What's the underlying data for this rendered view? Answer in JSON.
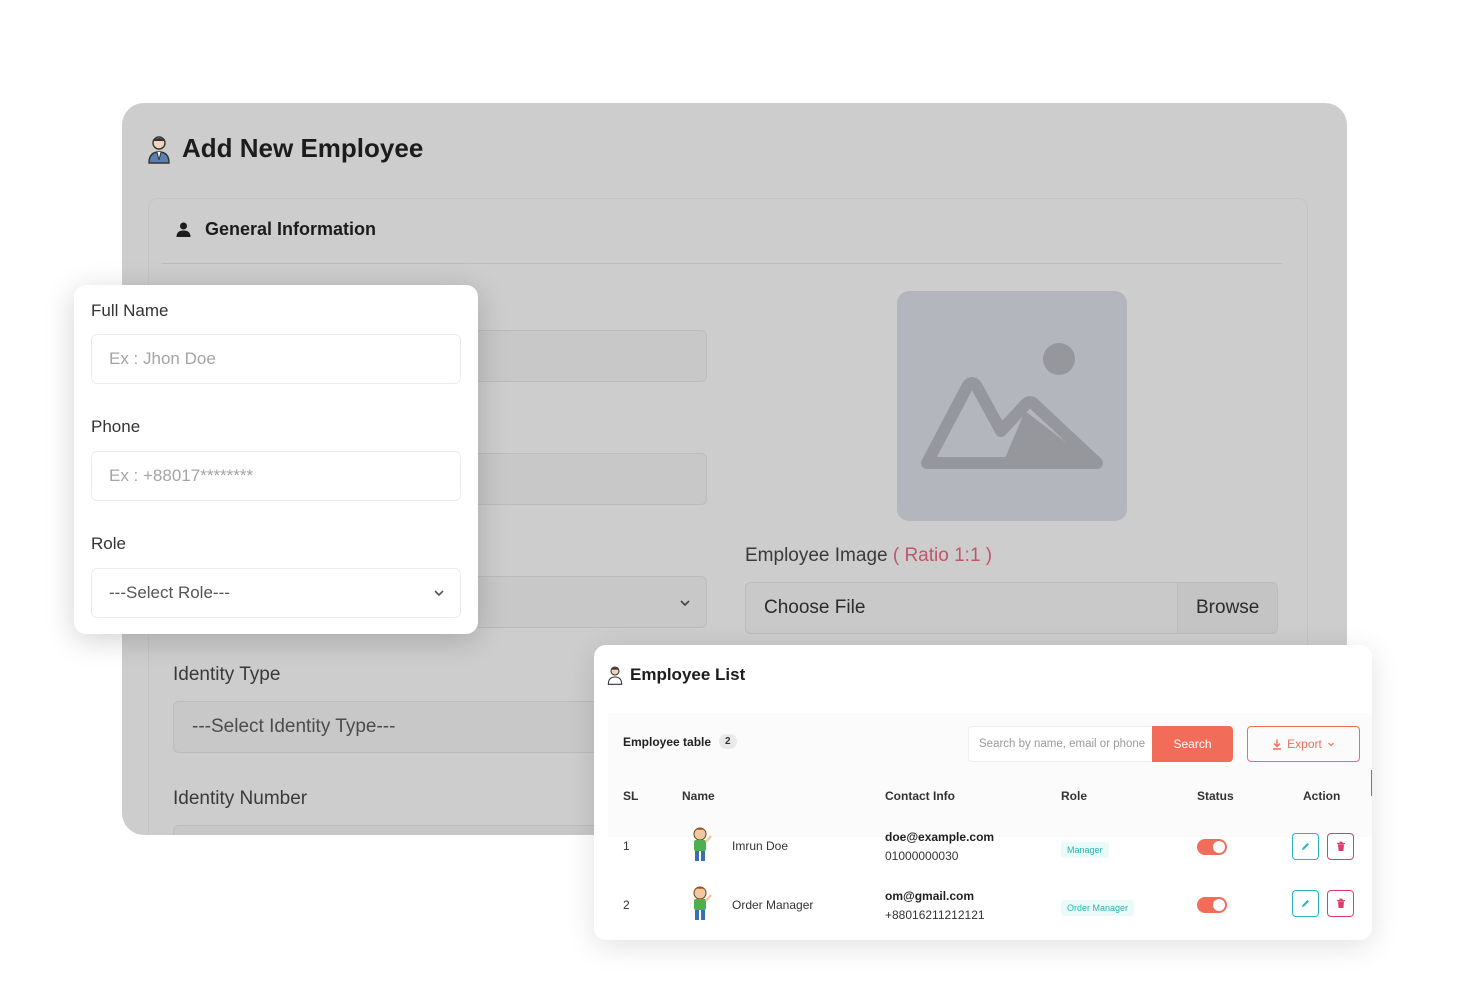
{
  "background_form": {
    "title": "Add New Employee",
    "section_title": "General Information",
    "identity_type_label": "Identity Type",
    "identity_type_placeholder": "---Select Identity Type---",
    "identity_number_label": "Identity Number",
    "employee_image_label": "Employee Image",
    "employee_image_ratio": "( Ratio 1:1 )",
    "file_input_text": "Choose File",
    "browse_label": "Browse"
  },
  "front_form": {
    "full_name_label": "Full Name",
    "full_name_placeholder": "Ex : Jhon Doe",
    "phone_label": "Phone",
    "phone_placeholder": "Ex : +88017********",
    "role_label": "Role",
    "role_selected": "---Select Role---"
  },
  "employee_list": {
    "title": "Employee List",
    "table_label": "Employee table",
    "table_count": "2",
    "search_placeholder": "Search by name, email or phone",
    "search_button": "Search",
    "export_button": "Export",
    "columns": [
      "SL",
      "Name",
      "Contact Info",
      "Role",
      "Status",
      "Action"
    ],
    "rows": [
      {
        "sl": "1",
        "name": "Imrun Doe",
        "email": "doe@example.com",
        "phone": "01000000030",
        "role": "Manager",
        "status_on": true
      },
      {
        "sl": "2",
        "name": "Order Manager",
        "email": "om@gmail.com",
        "phone": "+88016211212121",
        "role": "Order Manager",
        "status_on": true
      }
    ]
  },
  "colors": {
    "accent": "#f26c5a",
    "edit": "#27b4c8",
    "delete": "#e23a6d",
    "role_badge": "#2ab6b0",
    "ratio_text": "#c0566a"
  },
  "icons": [
    "employee-icon",
    "user-icon",
    "image-placeholder-icon",
    "chevron-down-icon",
    "download-icon",
    "edit-icon",
    "delete-icon"
  ]
}
